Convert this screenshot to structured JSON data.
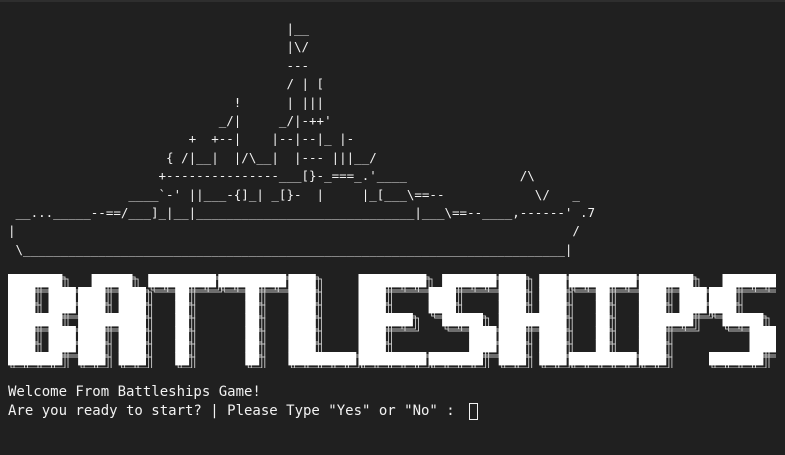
{
  "terminal": {
    "ascii_ship": "                                     |__\n                                     |\\/\n                                     ---\n                                     / | [\n                              !      | |||\n                            _/|     _/|-++'\n                        +  +--|    |--|--|_ |-\n                     { /|__|  |/\\__|  |--- |||__/\n                    +---------------___[}-_===_.'____               /\\\n                ____`-' ||___-{]_| _[}-  |     |_[___\\==--            \\/   _\n __..._____--==/___]_|__|_____________________________|___\\==--____,------' .7\n|                                                                          /\n \\________________________________________________________________________|",
    "banner_title": "BATTLESHIPS",
    "welcome_text": "Welcome From Battleships Game!",
    "prompt_text": "Are you ready to start? | Please Type \"Yes\" or \"No\" : ",
    "input_value": ""
  }
}
